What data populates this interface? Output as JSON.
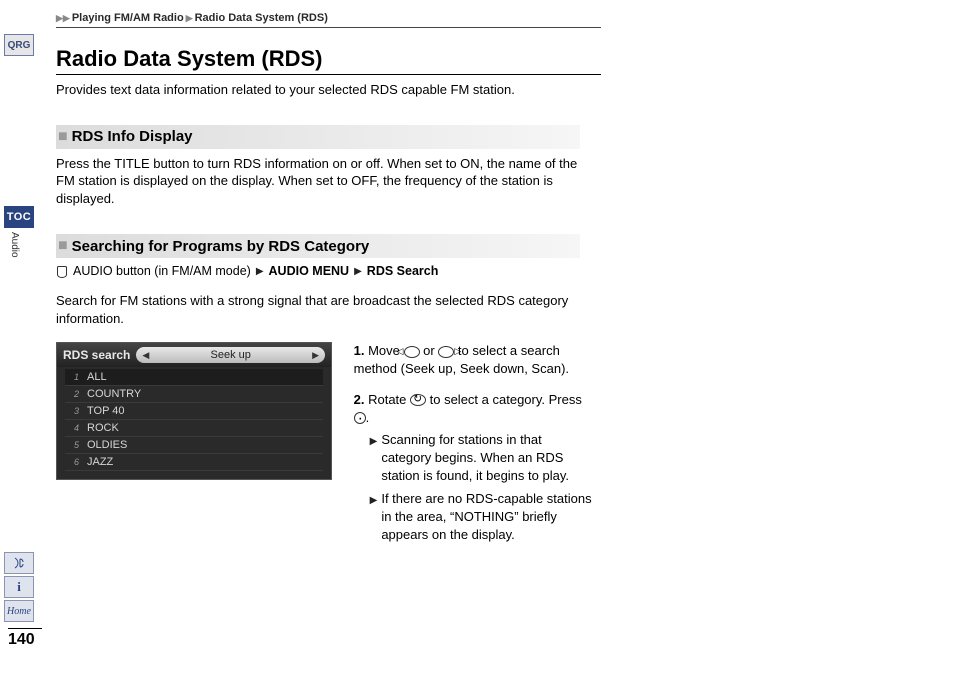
{
  "sidebar": {
    "qrg": "QRG",
    "toc": "TOC",
    "section": "Audio",
    "home_label": "Home"
  },
  "page_number": "140",
  "breadcrumb": {
    "level1": "Playing FM/AM Radio",
    "level2": "Radio Data System (RDS)"
  },
  "title": "Radio Data System (RDS)",
  "lead": "Provides text data information related to your selected RDS capable FM station.",
  "section1": {
    "heading": "RDS Info Display",
    "body": "Press the TITLE button to turn RDS information on or off. When set to ON, the name of the FM station is displayed on the display. When set to OFF, the frequency of the station is displayed."
  },
  "section2": {
    "heading": "Searching for Programs by RDS Category",
    "nav": {
      "pre": "AUDIO button (in FM/AM mode)",
      "step1": "AUDIO MENU",
      "step2": "RDS Search"
    },
    "intro": "Search for FM stations with a strong signal that are broadcast the selected RDS category information.",
    "device": {
      "title": "RDS search",
      "pill": "Seek up",
      "items": [
        "ALL",
        "COUNTRY",
        "TOP 40",
        "ROCK",
        "OLDIES",
        "JAZZ"
      ]
    },
    "steps": {
      "s1a": "Move ",
      "s1b": " or ",
      "s1c": " to select a search method (",
      "s1d": "Seek up",
      "s1e": ", ",
      "s1f": "Seek down, Scan",
      "s1g": ").",
      "s2a": "Rotate ",
      "s2b": " to select a category. Press ",
      "s2c": ".",
      "bullet1": "Scanning for stations in that category begins. When an RDS station is found, it begins to play.",
      "bullet2": "If there are no RDS-capable stations in the area, “NOTHING” briefly appears on the display."
    }
  }
}
